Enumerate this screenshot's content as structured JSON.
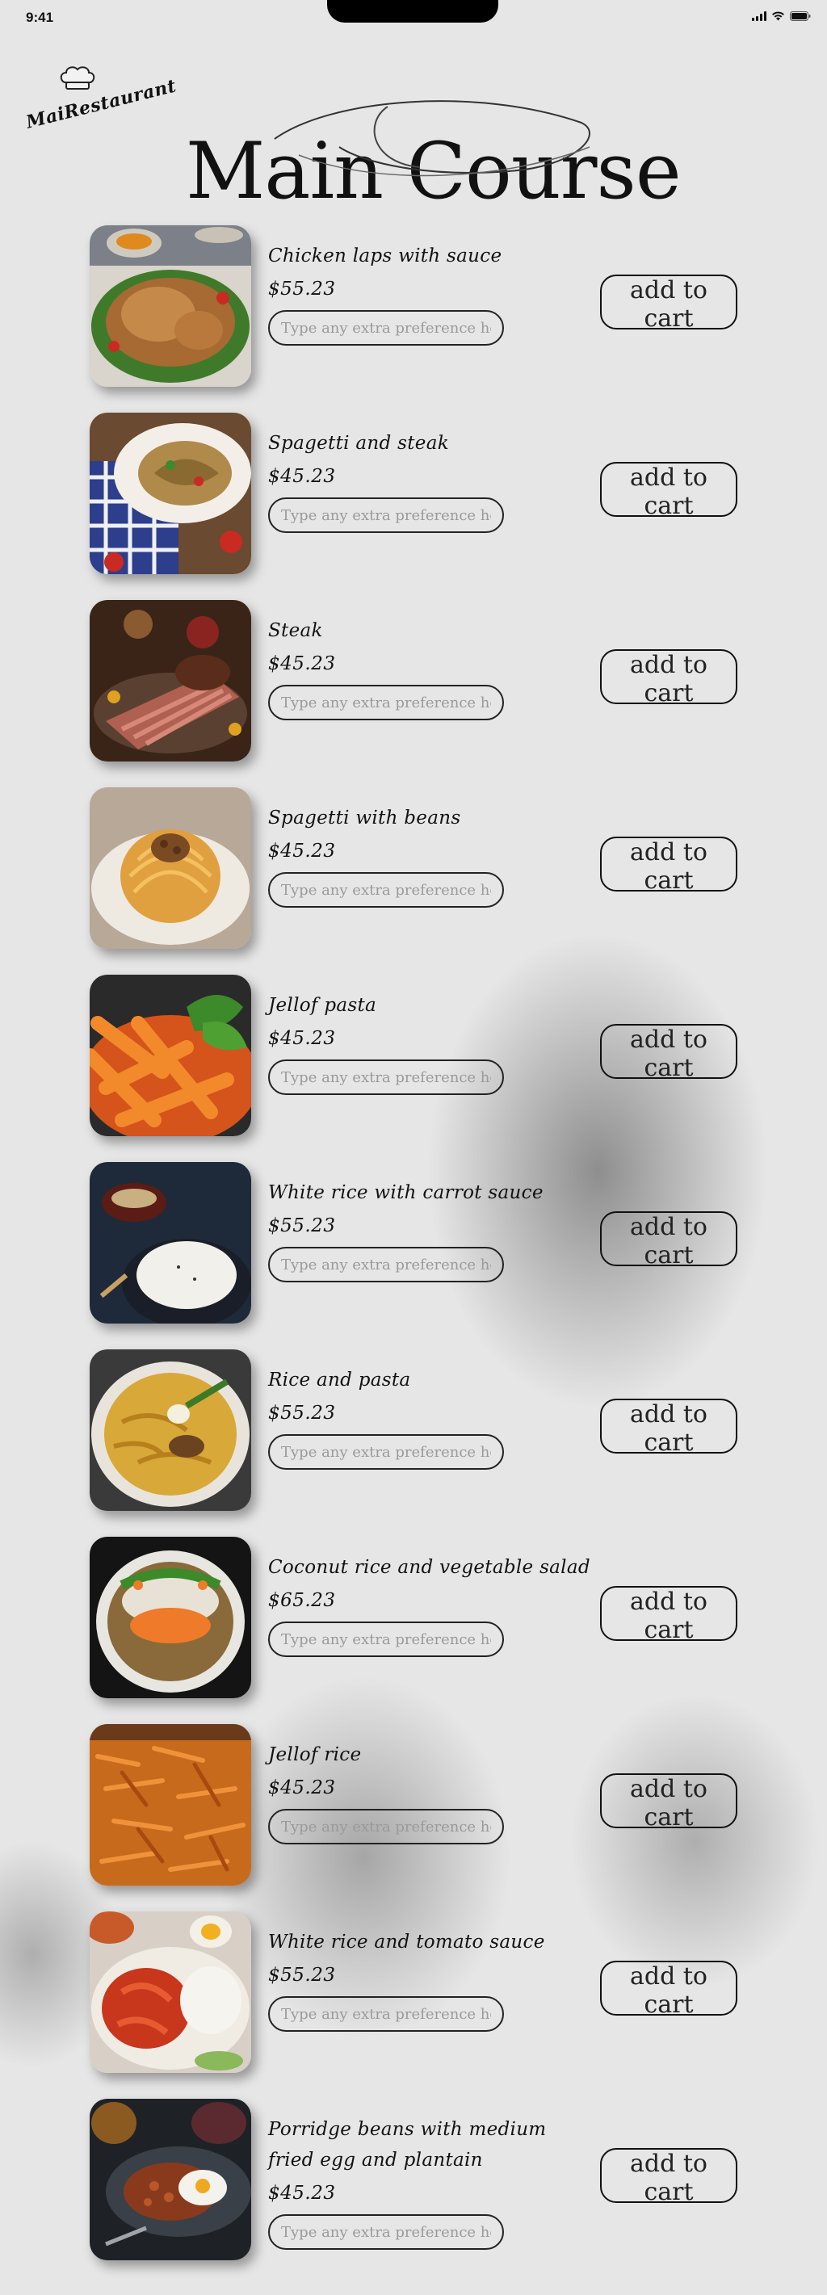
{
  "status_bar": {
    "time": "9:41"
  },
  "header": {
    "logo_text": "MaiRestaurant",
    "title": "Main Course"
  },
  "accent_color": "#111111",
  "items": [
    {
      "name": "Chicken laps with sauce",
      "price": "$55.23",
      "placeholder": "Type any extra preference here",
      "cart_label": "add to cart"
    },
    {
      "name": "Spagetti and steak",
      "price": "$45.23",
      "placeholder": "Type any extra preference here",
      "cart_label": "add to cart"
    },
    {
      "name": "Steak",
      "price": "$45.23",
      "placeholder": "Type any extra preference here",
      "cart_label": "add to cart"
    },
    {
      "name": "Spagetti with beans",
      "price": "$45.23",
      "placeholder": "Type any extra preference here",
      "cart_label": "add to cart"
    },
    {
      "name": "Jellof pasta",
      "price": "$45.23",
      "placeholder": "Type any extra preference here",
      "cart_label": "add to cart"
    },
    {
      "name": "White rice with carrot sauce",
      "price": "$55.23",
      "placeholder": "Type any extra preference here",
      "cart_label": "add to cart"
    },
    {
      "name": "Rice and pasta",
      "price": "$55.23",
      "placeholder": "Type any extra preference here",
      "cart_label": "add to cart"
    },
    {
      "name": "Coconut rice and vegetable salad",
      "price": "$65.23",
      "placeholder": "Type any extra preference here",
      "cart_label": "add to cart"
    },
    {
      "name": "Jellof rice",
      "price": "$45.23",
      "placeholder": "Type any extra preference here",
      "cart_label": "add to cart"
    },
    {
      "name": "White rice and tomato sauce",
      "price": "$55.23",
      "placeholder": "Type any extra preference here",
      "cart_label": "add to cart"
    },
    {
      "name": "Porridge beans with medium fried egg and plantain",
      "price": "$45.23",
      "placeholder": "Type any extra preference here",
      "cart_label": "add to cart"
    }
  ]
}
